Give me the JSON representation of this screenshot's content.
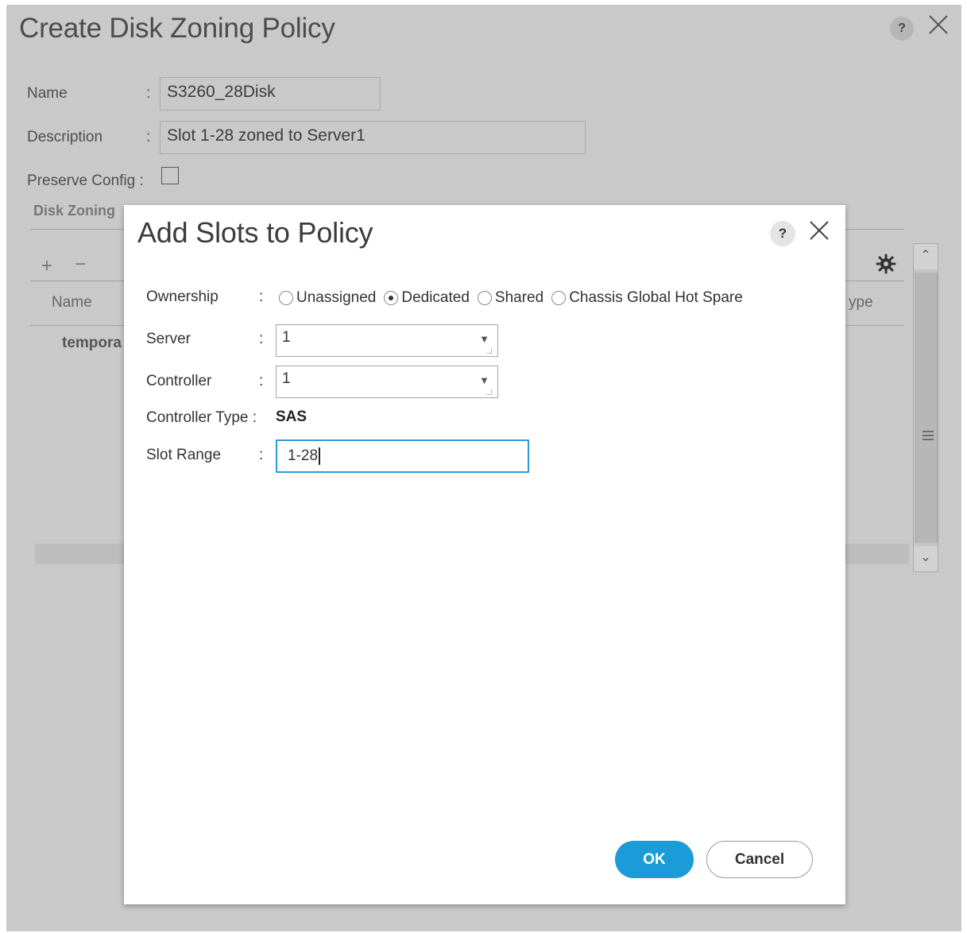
{
  "outer_dialog": {
    "title": "Create Disk Zoning Policy",
    "help_glyph": "?",
    "fields": {
      "name_label": "Name",
      "name_value": "S3260_28Disk",
      "description_label": "Description",
      "description_value": "Slot 1-28 zoned to  Server1",
      "preserve_config_label": "Preserve Config :",
      "colon": ":"
    },
    "section_title": "Disk Zoning",
    "toolbar": {
      "add_glyph": "+",
      "remove_glyph": "−"
    },
    "table": {
      "col_name": "Name",
      "col_type_partial": "ype",
      "first_row_partial": "tempora"
    }
  },
  "modal": {
    "title": "Add Slots to Policy",
    "help_glyph": "?",
    "colon": ":",
    "ownership_label": "Ownership",
    "ownership_options": [
      {
        "label": "Unassigned",
        "selected": false
      },
      {
        "label": "Dedicated",
        "selected": true
      },
      {
        "label": "Shared",
        "selected": false
      },
      {
        "label": "Chassis Global Hot Spare",
        "selected": false
      }
    ],
    "server_label": "Server",
    "server_value": "1",
    "controller_label": "Controller",
    "controller_value": "1",
    "controller_type_label": "Controller Type :",
    "controller_type_value": "SAS",
    "slot_range_label": "Slot Range",
    "slot_range_value": "1-28",
    "ok_label": "OK",
    "cancel_label": "Cancel"
  },
  "colors": {
    "accent": "#1b9bd7",
    "focus_border": "#2f9bd6",
    "overlay": "#c9c9c9"
  },
  "icons": [
    "help-icon",
    "close-icon",
    "gear-icon",
    "dropdown-arrow-icon",
    "scroll-up-icon",
    "scroll-down-icon"
  ]
}
